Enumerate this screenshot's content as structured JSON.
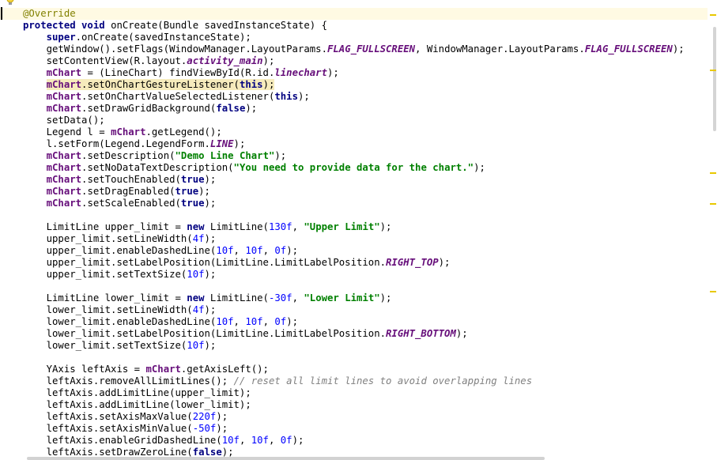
{
  "editor": {
    "lines": [
      [
        {
          "t": "@Override",
          "c": "ann"
        }
      ],
      [
        {
          "t": "protected void ",
          "c": "kw"
        },
        {
          "t": "onCreate(Bundle savedInstanceState) {"
        }
      ],
      [
        {
          "t": "    "
        },
        {
          "t": "super",
          "c": "kw"
        },
        {
          "t": ".onCreate(savedInstanceState);"
        }
      ],
      [
        {
          "t": "    getWindow().setFlags(WindowManager.LayoutParams."
        },
        {
          "t": "FLAG_FULLSCREEN",
          "c": "cst"
        },
        {
          "t": ", WindowManager.LayoutParams."
        },
        {
          "t": "FLAG_FULLSCREEN",
          "c": "cst"
        },
        {
          "t": ");"
        }
      ],
      [
        {
          "t": "    setContentView(R.layout."
        },
        {
          "t": "activity_main",
          "c": "cst"
        },
        {
          "t": ");"
        }
      ],
      [
        {
          "t": "    "
        },
        {
          "t": "mChart",
          "c": "fld"
        },
        {
          "t": " = (LineChart) findViewById(R.id."
        },
        {
          "t": "linechart",
          "c": "cst"
        },
        {
          "t": ");"
        }
      ],
      [
        {
          "t": "    "
        },
        {
          "t": "mChart",
          "c": "fld hl"
        },
        {
          "t": ".setOnChartGestureListener(",
          "c": "hl"
        },
        {
          "t": "this",
          "c": "kw hl"
        },
        {
          "t": ");",
          "c": "hl"
        }
      ],
      [
        {
          "t": "    "
        },
        {
          "t": "mChart",
          "c": "fld"
        },
        {
          "t": ".setOnChartValueSelectedListener("
        },
        {
          "t": "this",
          "c": "kw"
        },
        {
          "t": ");"
        }
      ],
      [
        {
          "t": "    "
        },
        {
          "t": "mChart",
          "c": "fld"
        },
        {
          "t": ".setDrawGridBackground("
        },
        {
          "t": "false",
          "c": "kw"
        },
        {
          "t": ");"
        }
      ],
      [
        {
          "t": "    setData();"
        }
      ],
      [
        {
          "t": "    Legend l = "
        },
        {
          "t": "mChart",
          "c": "fld"
        },
        {
          "t": ".getLegend();"
        }
      ],
      [
        {
          "t": "    l.setForm(Legend.LegendForm."
        },
        {
          "t": "LINE",
          "c": "cst"
        },
        {
          "t": ");"
        }
      ],
      [
        {
          "t": "    "
        },
        {
          "t": "mChart",
          "c": "fld"
        },
        {
          "t": ".setDescription("
        },
        {
          "t": "\"Demo Line Chart\"",
          "c": "str"
        },
        {
          "t": ");"
        }
      ],
      [
        {
          "t": "    "
        },
        {
          "t": "mChart",
          "c": "fld"
        },
        {
          "t": ".setNoDataTextDescription("
        },
        {
          "t": "\"You need to provide data for the chart.\"",
          "c": "str"
        },
        {
          "t": ");"
        }
      ],
      [
        {
          "t": "    "
        },
        {
          "t": "mChart",
          "c": "fld"
        },
        {
          "t": ".setTouchEnabled("
        },
        {
          "t": "true",
          "c": "kw"
        },
        {
          "t": ");"
        }
      ],
      [
        {
          "t": "    "
        },
        {
          "t": "mChart",
          "c": "fld"
        },
        {
          "t": ".setDragEnabled("
        },
        {
          "t": "true",
          "c": "kw"
        },
        {
          "t": ");"
        }
      ],
      [
        {
          "t": "    "
        },
        {
          "t": "mChart",
          "c": "fld"
        },
        {
          "t": ".setScaleEnabled("
        },
        {
          "t": "true",
          "c": "kw"
        },
        {
          "t": ");"
        }
      ],
      [],
      [
        {
          "t": "    LimitLine upper_limit = "
        },
        {
          "t": "new ",
          "c": "kw"
        },
        {
          "t": "LimitLine("
        },
        {
          "t": "130f",
          "c": "num"
        },
        {
          "t": ", "
        },
        {
          "t": "\"Upper Limit\"",
          "c": "str"
        },
        {
          "t": ");"
        }
      ],
      [
        {
          "t": "    upper_limit.setLineWidth("
        },
        {
          "t": "4f",
          "c": "num"
        },
        {
          "t": ");"
        }
      ],
      [
        {
          "t": "    upper_limit.enableDashedLine("
        },
        {
          "t": "10f",
          "c": "num"
        },
        {
          "t": ", "
        },
        {
          "t": "10f",
          "c": "num"
        },
        {
          "t": ", "
        },
        {
          "t": "0f",
          "c": "num"
        },
        {
          "t": ");"
        }
      ],
      [
        {
          "t": "    upper_limit.setLabelPosition(LimitLine.LimitLabelPosition."
        },
        {
          "t": "RIGHT_TOP",
          "c": "cst"
        },
        {
          "t": ");"
        }
      ],
      [
        {
          "t": "    upper_limit.setTextSize("
        },
        {
          "t": "10f",
          "c": "num"
        },
        {
          "t": ");"
        }
      ],
      [],
      [
        {
          "t": "    LimitLine lower_limit = "
        },
        {
          "t": "new ",
          "c": "kw"
        },
        {
          "t": "LimitLine("
        },
        {
          "t": "-30f",
          "c": "num"
        },
        {
          "t": ", "
        },
        {
          "t": "\"Lower Limit\"",
          "c": "str"
        },
        {
          "t": ");"
        }
      ],
      [
        {
          "t": "    lower_limit.setLineWidth("
        },
        {
          "t": "4f",
          "c": "num"
        },
        {
          "t": ");"
        }
      ],
      [
        {
          "t": "    lower_limit.enableDashedLine("
        },
        {
          "t": "10f",
          "c": "num"
        },
        {
          "t": ", "
        },
        {
          "t": "10f",
          "c": "num"
        },
        {
          "t": ", "
        },
        {
          "t": "0f",
          "c": "num"
        },
        {
          "t": ");"
        }
      ],
      [
        {
          "t": "    lower_limit.setLabelPosition(LimitLine.LimitLabelPosition."
        },
        {
          "t": "RIGHT_BOTTOM",
          "c": "cst"
        },
        {
          "t": ");"
        }
      ],
      [
        {
          "t": "    lower_limit.setTextSize("
        },
        {
          "t": "10f",
          "c": "num"
        },
        {
          "t": ");"
        }
      ],
      [],
      [
        {
          "t": "    YAxis leftAxis = "
        },
        {
          "t": "mChart",
          "c": "fld"
        },
        {
          "t": ".getAxisLeft();"
        }
      ],
      [
        {
          "t": "    leftAxis.removeAllLimitLines(); "
        },
        {
          "t": "// reset all limit lines to avoid overlapping lines",
          "c": "cmt"
        }
      ],
      [
        {
          "t": "    leftAxis.addLimitLine(upper_limit);"
        }
      ],
      [
        {
          "t": "    leftAxis.addLimitLine(lower_limit);"
        }
      ],
      [
        {
          "t": "    leftAxis.setAxisMaxValue("
        },
        {
          "t": "220f",
          "c": "num"
        },
        {
          "t": ");"
        }
      ],
      [
        {
          "t": "    leftAxis.setAxisMinValue("
        },
        {
          "t": "-50f",
          "c": "num"
        },
        {
          "t": ");"
        }
      ],
      [
        {
          "t": "    leftAxis.enableGridDashedLine("
        },
        {
          "t": "10f",
          "c": "num"
        },
        {
          "t": ", "
        },
        {
          "t": "10f",
          "c": "num"
        },
        {
          "t": ", "
        },
        {
          "t": "0f",
          "c": "num"
        },
        {
          "t": ");"
        }
      ],
      [
        {
          "t": "    leftAxis.setDrawZeroLine("
        },
        {
          "t": "false",
          "c": "kw"
        },
        {
          "t": ");"
        }
      ]
    ],
    "caret_line": 0,
    "highlight_line": 6
  },
  "icons": {
    "intention": "lightbulb-icon"
  },
  "colors": {
    "warning_marker": "#e8c800",
    "annotation": "#808000",
    "keyword": "#000080",
    "field": "#660e7a",
    "string": "#008000",
    "number": "#0000ff",
    "comment": "#808080"
  }
}
